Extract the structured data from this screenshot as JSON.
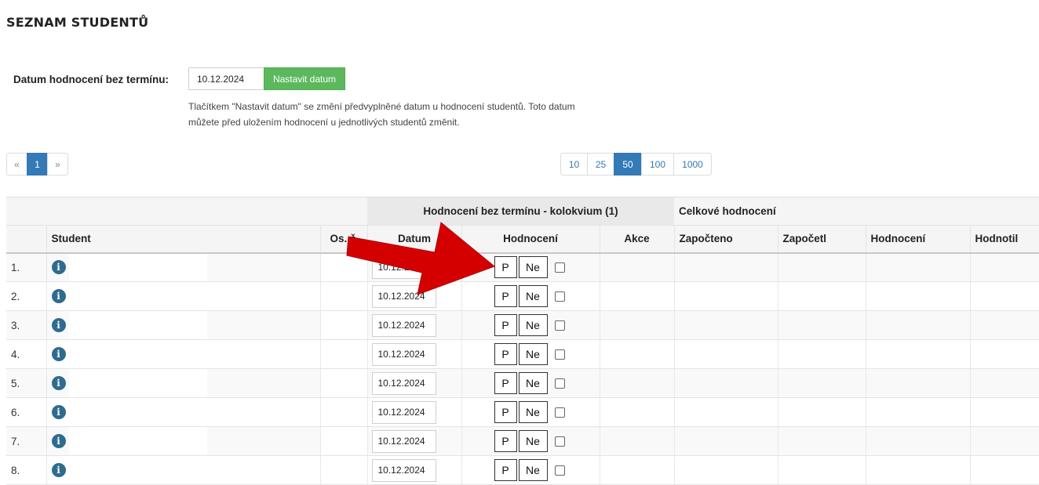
{
  "page": {
    "title": "SEZNAM STUDENTŮ"
  },
  "date_form": {
    "label": "Datum hodnocení bez termínu:",
    "value": "10.12.2024",
    "button_label": "Nastavit datum",
    "help_text": "Tlačítkem \"Nastavit datum\" se změní předvyplněné datum u hodnocení studentů. Toto datum můžete před uložením hodnocení u jednotlivých studentů změnit."
  },
  "pagination": {
    "prev": "«",
    "pages": [
      "1"
    ],
    "current": "1",
    "next": "»"
  },
  "page_size": {
    "options": [
      "10",
      "25",
      "50",
      "100",
      "1000"
    ],
    "selected": "50"
  },
  "table": {
    "group_headers": {
      "evaluation": "Hodnocení bez termínu - kolokvium (1)",
      "overall": "Celkové hodnocení"
    },
    "columns": {
      "student": "Student",
      "os_cislo": "Os. č",
      "datum": "Datum",
      "hodnoceni": "Hodnocení",
      "akce": "Akce",
      "zapocteno": "Započteno",
      "zapocetl": "Započetl",
      "hodnoceni_overall": "Hodnocení",
      "hodnotil": "Hodnotil"
    },
    "grade_buttons": {
      "pass": "P",
      "fail": "Ne"
    },
    "rows": [
      {
        "num": "1.",
        "date": "10.12.2024"
      },
      {
        "num": "2.",
        "date": "10.12.2024"
      },
      {
        "num": "3.",
        "date": "10.12.2024"
      },
      {
        "num": "4.",
        "date": "10.12.2024"
      },
      {
        "num": "5.",
        "date": "10.12.2024"
      },
      {
        "num": "6.",
        "date": "10.12.2024"
      },
      {
        "num": "7.",
        "date": "10.12.2024"
      },
      {
        "num": "8.",
        "date": "10.12.2024"
      }
    ]
  },
  "icons": {
    "info": "info-icon",
    "annotation": "red-arrow-icon"
  },
  "colors": {
    "primary": "#337ab7",
    "success": "#5cb85c",
    "info_icon": "#2e6b8f",
    "annotation_arrow": "#d40000"
  }
}
